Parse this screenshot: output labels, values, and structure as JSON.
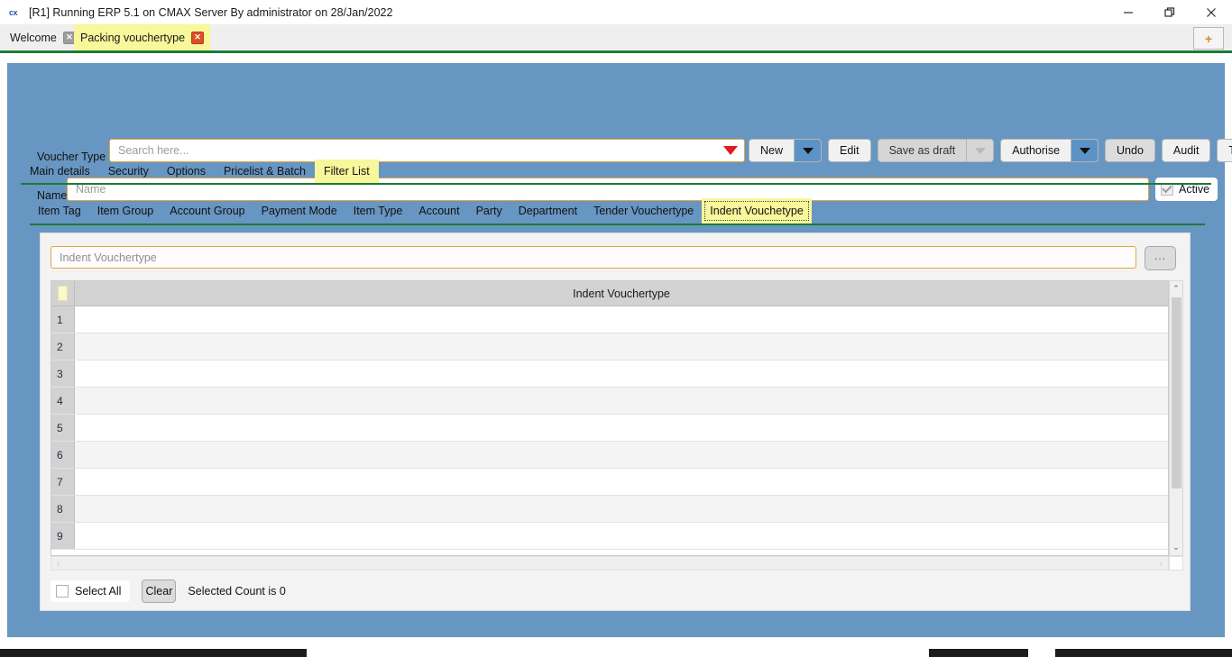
{
  "window": {
    "title": "[R1] Running ERP 5.1 on CMAX Server By administrator on 28/Jan/2022",
    "app_icon": "cx",
    "minimize_icon": "minimize-icon",
    "maximize_icon": "restore-icon",
    "close_icon": "close-icon"
  },
  "tabstrip": {
    "tabs": [
      {
        "label": "Welcome",
        "active": false,
        "close": "✕"
      },
      {
        "label": "Packing vouchertype",
        "active": true,
        "close": "✕"
      }
    ],
    "new_tab_label": "+"
  },
  "form": {
    "voucher_type_label": "Voucher Type",
    "voucher_type_placeholder": "Search here...",
    "voucher_type_value": "",
    "name_label": "Name",
    "name_placeholder": "Name",
    "name_value": "",
    "active_label": "Active",
    "active_checked": true
  },
  "toolbar": {
    "buttons": [
      {
        "label": "New",
        "has_split": true,
        "disabled": false
      },
      {
        "label": "Edit",
        "has_split": false,
        "disabled": false
      },
      {
        "label": "Save as draft",
        "has_split": true,
        "disabled": true
      },
      {
        "label": "Authorise",
        "has_split": true,
        "disabled": false
      },
      {
        "label": "Undo",
        "has_split": false,
        "disabled": false,
        "shaded": true
      },
      {
        "label": "Audit",
        "has_split": false,
        "disabled": false
      },
      {
        "label": "Template",
        "has_split": false,
        "disabled": false
      }
    ]
  },
  "primary_tabs": [
    {
      "label": "Main details",
      "active": false
    },
    {
      "label": "Security",
      "active": false
    },
    {
      "label": "Options",
      "active": false
    },
    {
      "label": "Pricelist & Batch",
      "active": false
    },
    {
      "label": "Filter List",
      "active": true
    }
  ],
  "secondary_tabs": [
    {
      "label": "Item Tag",
      "active": false
    },
    {
      "label": "Item Group",
      "active": false
    },
    {
      "label": "Account Group",
      "active": false
    },
    {
      "label": "Payment Mode",
      "active": false
    },
    {
      "label": "Item Type",
      "active": false
    },
    {
      "label": "Account",
      "active": false
    },
    {
      "label": "Party",
      "active": false
    },
    {
      "label": "Department",
      "active": false
    },
    {
      "label": "Tender Vouchertype",
      "active": false
    },
    {
      "label": "Indent Vouchetype",
      "active": true
    }
  ],
  "panel": {
    "search_placeholder": "Indent Vouchertype",
    "search_value": "",
    "browse_label": "...",
    "grid": {
      "column_header": "Indent Vouchertype",
      "rows": [
        {
          "num": "1",
          "value": ""
        },
        {
          "num": "2",
          "value": ""
        },
        {
          "num": "3",
          "value": ""
        },
        {
          "num": "4",
          "value": ""
        },
        {
          "num": "5",
          "value": ""
        },
        {
          "num": "6",
          "value": ""
        },
        {
          "num": "7",
          "value": ""
        },
        {
          "num": "8",
          "value": ""
        },
        {
          "num": "9",
          "value": ""
        }
      ]
    },
    "scrollbar": {
      "up_arrow": "⌃",
      "down_arrow": "⌄",
      "left_arrow": "‹",
      "right_arrow": "›"
    },
    "footer": {
      "select_all_label": "Select All",
      "select_all_checked": false,
      "clear_label": "Clear",
      "selected_count_text": "Selected Count is 0"
    }
  },
  "colors": {
    "body_blue": "#6796c2",
    "accent_green": "#1d7a36",
    "highlight_yellow": "#f7f79b",
    "field_border_orange": "#e8a33d",
    "split_blue": "#5b93c6"
  }
}
